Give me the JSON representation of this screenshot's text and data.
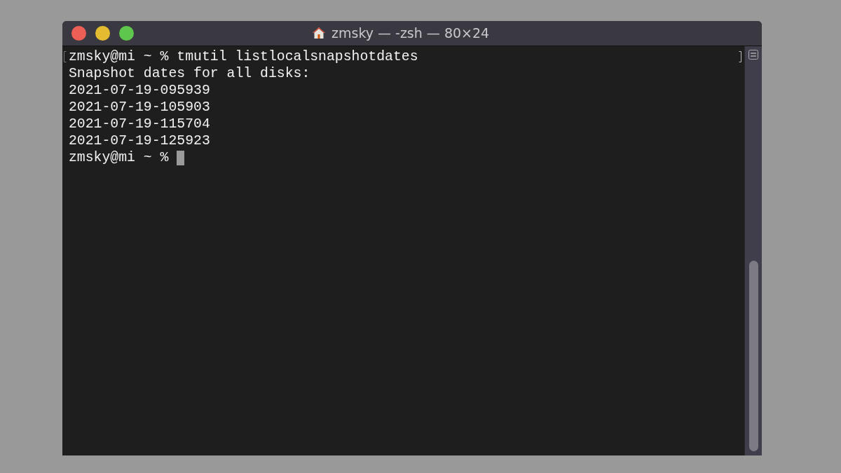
{
  "window": {
    "title": "zmsky — -zsh — 80×24"
  },
  "lines": [
    {
      "kind": "command",
      "text": "zmsky@mi ~ % tmutil listlocalsnapshotdates"
    },
    {
      "kind": "output",
      "text": "Snapshot dates for all disks:"
    },
    {
      "kind": "output",
      "text": "2021-07-19-095939"
    },
    {
      "kind": "output",
      "text": "2021-07-19-105903"
    },
    {
      "kind": "output",
      "text": "2021-07-19-115704"
    },
    {
      "kind": "output",
      "text": "2021-07-19-125923"
    },
    {
      "kind": "prompt",
      "text": "zmsky@mi ~ %"
    }
  ]
}
